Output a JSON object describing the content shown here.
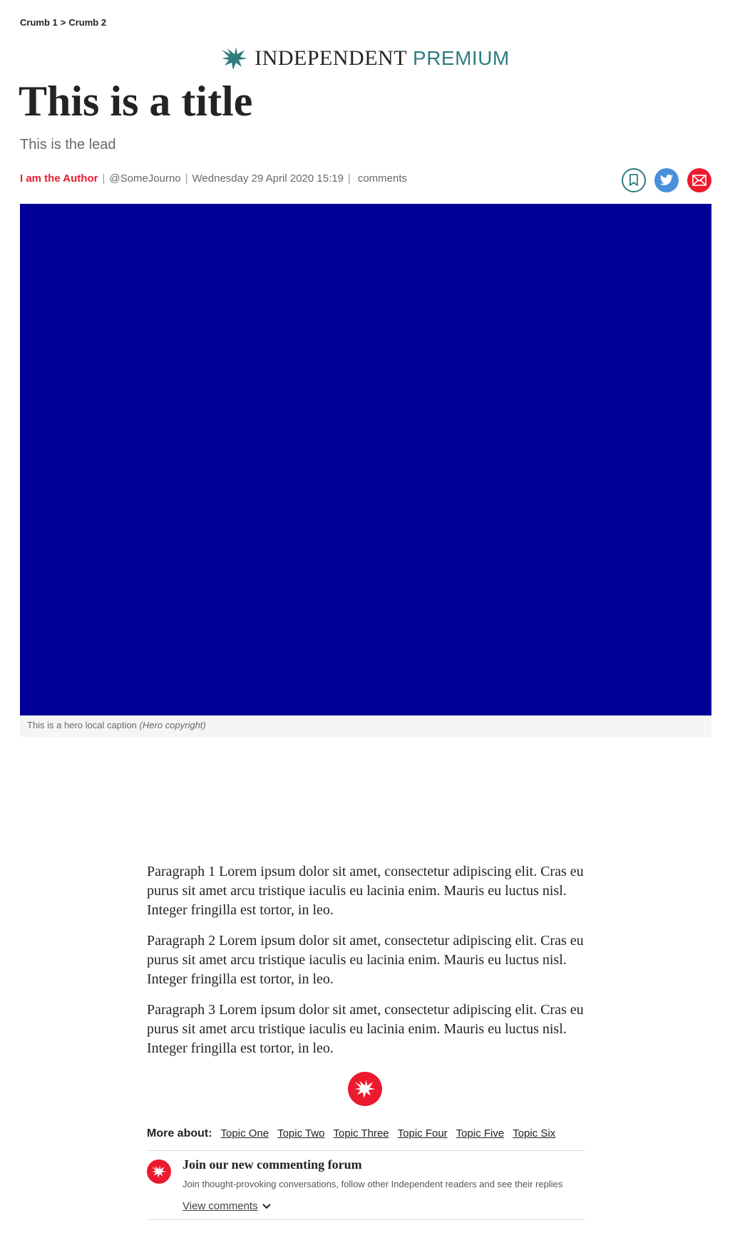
{
  "breadcrumb": {
    "items": [
      "Crumb 1",
      "Crumb 2"
    ],
    "separator": ">"
  },
  "masthead": {
    "brand": "INDEPENDENT",
    "premium": "PREMIUM",
    "logo_icon": "eagle-icon",
    "premium_color": "#2f7c7f"
  },
  "article": {
    "title": "This is a title",
    "lead": "This is the lead",
    "byline": {
      "author": "I am the Author",
      "handle": "@SomeJourno",
      "date": "Wednesday 29 April 2020 15:19",
      "comments": "comments"
    },
    "share": {
      "bookmark_icon": "bookmark-icon",
      "twitter_icon": "twitter-icon",
      "email_icon": "email-icon"
    },
    "hero": {
      "color": "#000099",
      "caption": "This is a hero local caption",
      "copyright": "(Hero copyright)"
    },
    "paragraphs": [
      "Paragraph 1 Lorem ipsum dolor sit amet, consectetur adipiscing elit. Cras eu purus sit amet arcu tristique iaculis eu lacinia enim. Mauris eu luctus nisl. Integer fringilla est tortor, in leo.",
      "Paragraph 2 Lorem ipsum dolor sit amet, consectetur adipiscing elit. Cras eu purus sit amet arcu tristique iaculis eu lacinia enim. Mauris eu luctus nisl. Integer fringilla est tortor, in leo.",
      "Paragraph 3 Lorem ipsum dolor sit amet, consectetur adipiscing elit. Cras eu purus sit amet arcu tristique iaculis eu lacinia enim. Mauris eu luctus nisl. Integer fringilla est tortor, in leo."
    ]
  },
  "more_about": {
    "label": "More about:",
    "topics": [
      "Topic One",
      "Topic Two",
      "Topic Three",
      "Topic Four",
      "Topic Five",
      "Topic Six"
    ]
  },
  "forum": {
    "heading": "Join our new commenting forum",
    "subtext": "Join thought-provoking conversations, follow other Independent readers and see their replies",
    "view_label": "View comments"
  },
  "colors": {
    "accent_red": "#ec1a2e",
    "teal": "#2f7c7f",
    "twitter_blue": "#4a8fdc"
  }
}
